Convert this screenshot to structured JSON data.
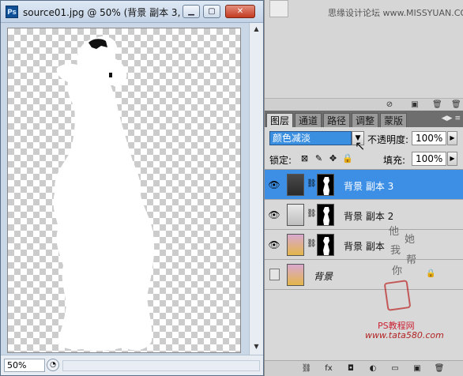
{
  "document": {
    "title": "source01.jpg @ 50% (背景 副本 3, ...",
    "app_icon": "Ps",
    "zoom": "50%"
  },
  "top_panel": {
    "watermark": "思缘设计论坛  www.MISSYUAN.COM"
  },
  "layers_panel": {
    "tabs": [
      "图层",
      "通道",
      "路径",
      "调整",
      "蒙版"
    ],
    "active_tab": "图层",
    "blend_mode": "颜色减淡",
    "opacity_label": "不透明度:",
    "opacity_value": "100%",
    "lock_label": "锁定:",
    "fill_label": "填充:",
    "fill_value": "100%",
    "layers": [
      {
        "name": "背景 副本 3",
        "visible": true,
        "selected": true,
        "has_mask": true
      },
      {
        "name": "背景 副本 2",
        "visible": true,
        "selected": false,
        "has_mask": true
      },
      {
        "name": "背景 副本",
        "visible": true,
        "selected": false,
        "has_mask": true
      },
      {
        "name": "背景",
        "visible": false,
        "selected": false,
        "has_mask": false,
        "locked": true
      }
    ]
  },
  "watermarks": {
    "ps_text": "PS教程网",
    "site": "www.tata580.com",
    "handwriting": [
      "他",
      "她",
      "我",
      "帮",
      "你"
    ]
  },
  "colors": {
    "selection": "#3d8fe6",
    "canvas_checker": "#cccccc"
  }
}
